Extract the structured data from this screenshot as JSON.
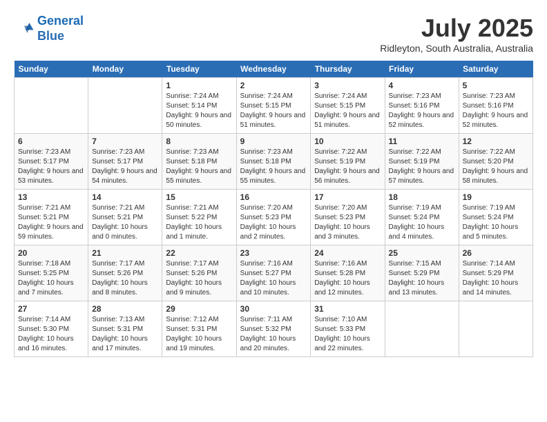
{
  "header": {
    "logo_line1": "General",
    "logo_line2": "Blue",
    "month": "July 2025",
    "location": "Ridleyton, South Australia, Australia"
  },
  "days_of_week": [
    "Sunday",
    "Monday",
    "Tuesday",
    "Wednesday",
    "Thursday",
    "Friday",
    "Saturday"
  ],
  "weeks": [
    [
      {
        "day": "",
        "sunrise": "",
        "sunset": "",
        "daylight": "",
        "empty": true
      },
      {
        "day": "",
        "sunrise": "",
        "sunset": "",
        "daylight": "",
        "empty": true
      },
      {
        "day": "1",
        "sunrise": "Sunrise: 7:24 AM",
        "sunset": "Sunset: 5:14 PM",
        "daylight": "Daylight: 9 hours and 50 minutes."
      },
      {
        "day": "2",
        "sunrise": "Sunrise: 7:24 AM",
        "sunset": "Sunset: 5:15 PM",
        "daylight": "Daylight: 9 hours and 51 minutes."
      },
      {
        "day": "3",
        "sunrise": "Sunrise: 7:24 AM",
        "sunset": "Sunset: 5:15 PM",
        "daylight": "Daylight: 9 hours and 51 minutes."
      },
      {
        "day": "4",
        "sunrise": "Sunrise: 7:23 AM",
        "sunset": "Sunset: 5:16 PM",
        "daylight": "Daylight: 9 hours and 52 minutes."
      },
      {
        "day": "5",
        "sunrise": "Sunrise: 7:23 AM",
        "sunset": "Sunset: 5:16 PM",
        "daylight": "Daylight: 9 hours and 52 minutes."
      }
    ],
    [
      {
        "day": "6",
        "sunrise": "Sunrise: 7:23 AM",
        "sunset": "Sunset: 5:17 PM",
        "daylight": "Daylight: 9 hours and 53 minutes."
      },
      {
        "day": "7",
        "sunrise": "Sunrise: 7:23 AM",
        "sunset": "Sunset: 5:17 PM",
        "daylight": "Daylight: 9 hours and 54 minutes."
      },
      {
        "day": "8",
        "sunrise": "Sunrise: 7:23 AM",
        "sunset": "Sunset: 5:18 PM",
        "daylight": "Daylight: 9 hours and 55 minutes."
      },
      {
        "day": "9",
        "sunrise": "Sunrise: 7:23 AM",
        "sunset": "Sunset: 5:18 PM",
        "daylight": "Daylight: 9 hours and 55 minutes."
      },
      {
        "day": "10",
        "sunrise": "Sunrise: 7:22 AM",
        "sunset": "Sunset: 5:19 PM",
        "daylight": "Daylight: 9 hours and 56 minutes."
      },
      {
        "day": "11",
        "sunrise": "Sunrise: 7:22 AM",
        "sunset": "Sunset: 5:19 PM",
        "daylight": "Daylight: 9 hours and 57 minutes."
      },
      {
        "day": "12",
        "sunrise": "Sunrise: 7:22 AM",
        "sunset": "Sunset: 5:20 PM",
        "daylight": "Daylight: 9 hours and 58 minutes."
      }
    ],
    [
      {
        "day": "13",
        "sunrise": "Sunrise: 7:21 AM",
        "sunset": "Sunset: 5:21 PM",
        "daylight": "Daylight: 9 hours and 59 minutes."
      },
      {
        "day": "14",
        "sunrise": "Sunrise: 7:21 AM",
        "sunset": "Sunset: 5:21 PM",
        "daylight": "Daylight: 10 hours and 0 minutes."
      },
      {
        "day": "15",
        "sunrise": "Sunrise: 7:21 AM",
        "sunset": "Sunset: 5:22 PM",
        "daylight": "Daylight: 10 hours and 1 minute."
      },
      {
        "day": "16",
        "sunrise": "Sunrise: 7:20 AM",
        "sunset": "Sunset: 5:23 PM",
        "daylight": "Daylight: 10 hours and 2 minutes."
      },
      {
        "day": "17",
        "sunrise": "Sunrise: 7:20 AM",
        "sunset": "Sunset: 5:23 PM",
        "daylight": "Daylight: 10 hours and 3 minutes."
      },
      {
        "day": "18",
        "sunrise": "Sunrise: 7:19 AM",
        "sunset": "Sunset: 5:24 PM",
        "daylight": "Daylight: 10 hours and 4 minutes."
      },
      {
        "day": "19",
        "sunrise": "Sunrise: 7:19 AM",
        "sunset": "Sunset: 5:24 PM",
        "daylight": "Daylight: 10 hours and 5 minutes."
      }
    ],
    [
      {
        "day": "20",
        "sunrise": "Sunrise: 7:18 AM",
        "sunset": "Sunset: 5:25 PM",
        "daylight": "Daylight: 10 hours and 7 minutes."
      },
      {
        "day": "21",
        "sunrise": "Sunrise: 7:17 AM",
        "sunset": "Sunset: 5:26 PM",
        "daylight": "Daylight: 10 hours and 8 minutes."
      },
      {
        "day": "22",
        "sunrise": "Sunrise: 7:17 AM",
        "sunset": "Sunset: 5:26 PM",
        "daylight": "Daylight: 10 hours and 9 minutes."
      },
      {
        "day": "23",
        "sunrise": "Sunrise: 7:16 AM",
        "sunset": "Sunset: 5:27 PM",
        "daylight": "Daylight: 10 hours and 10 minutes."
      },
      {
        "day": "24",
        "sunrise": "Sunrise: 7:16 AM",
        "sunset": "Sunset: 5:28 PM",
        "daylight": "Daylight: 10 hours and 12 minutes."
      },
      {
        "day": "25",
        "sunrise": "Sunrise: 7:15 AM",
        "sunset": "Sunset: 5:29 PM",
        "daylight": "Daylight: 10 hours and 13 minutes."
      },
      {
        "day": "26",
        "sunrise": "Sunrise: 7:14 AM",
        "sunset": "Sunset: 5:29 PM",
        "daylight": "Daylight: 10 hours and 14 minutes."
      }
    ],
    [
      {
        "day": "27",
        "sunrise": "Sunrise: 7:14 AM",
        "sunset": "Sunset: 5:30 PM",
        "daylight": "Daylight: 10 hours and 16 minutes."
      },
      {
        "day": "28",
        "sunrise": "Sunrise: 7:13 AM",
        "sunset": "Sunset: 5:31 PM",
        "daylight": "Daylight: 10 hours and 17 minutes."
      },
      {
        "day": "29",
        "sunrise": "Sunrise: 7:12 AM",
        "sunset": "Sunset: 5:31 PM",
        "daylight": "Daylight: 10 hours and 19 minutes."
      },
      {
        "day": "30",
        "sunrise": "Sunrise: 7:11 AM",
        "sunset": "Sunset: 5:32 PM",
        "daylight": "Daylight: 10 hours and 20 minutes."
      },
      {
        "day": "31",
        "sunrise": "Sunrise: 7:10 AM",
        "sunset": "Sunset: 5:33 PM",
        "daylight": "Daylight: 10 hours and 22 minutes."
      },
      {
        "day": "",
        "sunrise": "",
        "sunset": "",
        "daylight": "",
        "empty": true
      },
      {
        "day": "",
        "sunrise": "",
        "sunset": "",
        "daylight": "",
        "empty": true
      }
    ]
  ]
}
